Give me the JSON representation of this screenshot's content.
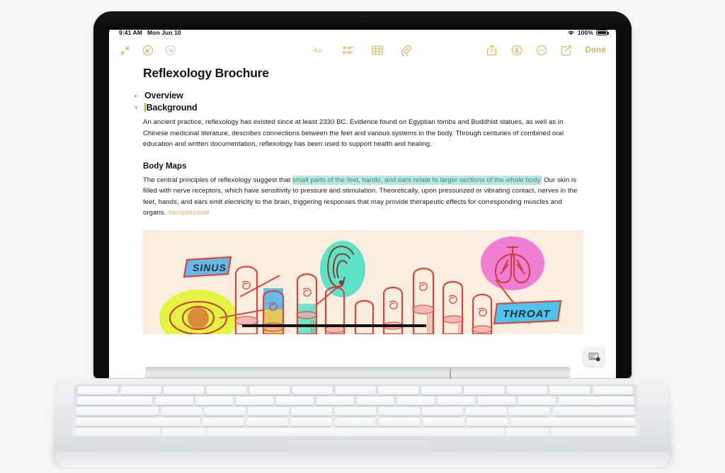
{
  "device": {
    "name": "ipad-with-magic-keyboard",
    "status_bar": {
      "time": "9:41 AM",
      "date": "Mon Jun 10",
      "wifi_icon": "wifi-icon",
      "battery_percent": "100%",
      "battery_icon": "battery-full-icon"
    }
  },
  "toolbar": {
    "left": [
      {
        "icon": "collapse-arrows-icon",
        "label": "Collapse"
      },
      {
        "icon": "undo-icon",
        "label": "Undo"
      },
      {
        "icon": "redo-icon",
        "label": "Redo"
      }
    ],
    "center": [
      {
        "icon": "format-text-icon",
        "label": "Aa"
      },
      {
        "icon": "checklist-icon",
        "label": "Checklist"
      },
      {
        "icon": "table-icon",
        "label": "Table"
      },
      {
        "icon": "attachment-paperclip-icon",
        "label": "Attach"
      }
    ],
    "right": [
      {
        "icon": "share-icon",
        "label": "Share"
      },
      {
        "icon": "markup-pen-circle-icon",
        "label": "Markup"
      },
      {
        "icon": "more-ellipsis-circle-icon",
        "label": "More"
      },
      {
        "icon": "compose-new-note-icon",
        "label": "New Note"
      }
    ],
    "done_label": "Done",
    "accent_color": "#d6b45e",
    "disabled_color": "#c9c9cb"
  },
  "note": {
    "title": "Reflexology Brochure",
    "sections": [
      {
        "heading": "Overview",
        "collapsed": true,
        "chevron": "chevron-right-icon"
      },
      {
        "heading": "Background",
        "collapsed": false,
        "chevron": "chevron-down-icon"
      }
    ],
    "background_paragraph": "An ancient practice, reflexology has existed since at least 2330 BC. Evidence found on Egyptian tombs and Buddhist statues, as well as in Chinese medicinal literature, describes connections between the feet and various systems in the body. Through centuries of combined oral education and written documentation, reflexology has been used to support health and healing.",
    "body_maps": {
      "heading": "Body Maps",
      "text_before_highlight": "The central principles of reflexology suggest that ",
      "highlighted_text": "small parts of the feet, hands, and ears relate to larger sections of the whole body.",
      "text_after_highlight": " Our skin is filled with nerve receptors, which have sensitivity to pressure and stimulation. Theoretically, upon pressurized or vibrating contact, nerves in the feet, hands, and ears emit electricity to the brain, triggering responses that may provide therapeutic effects for corresponding muscles and organs. ",
      "hashtag": "#acupressure",
      "highlight_color": "#b9e8da",
      "highlight_text_color": "#3f8d7c",
      "hashtag_color": "#d8b060"
    },
    "illustration": {
      "name": "reflexology-hand-diagram",
      "background_color": "#fbeede",
      "ink_color": "#d9453f",
      "labels": [
        {
          "text": "SINUS",
          "fill": "#66b8e8"
        },
        {
          "text": "THROAT",
          "fill": "#4cc4ee"
        }
      ],
      "organs": [
        {
          "name": "eye-illustration",
          "highlight": "#e2f23a"
        },
        {
          "name": "ear-illustration",
          "highlight": "#5fe3c8"
        },
        {
          "name": "lungs-illustration",
          "highlight": "#ef7fd2"
        },
        {
          "name": "sinus-fingertip-highlight",
          "highlight": "#5ab7e8"
        }
      ]
    }
  },
  "floating_button": {
    "icon": "dismiss-keyboard-icon",
    "label": "Hide Keyboard"
  }
}
